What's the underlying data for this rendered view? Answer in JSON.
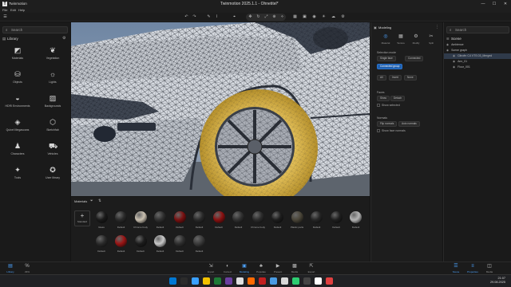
{
  "window": {
    "app_name": "Twinmotion",
    "title": "Twinmotion 2025.1.1 - Ohnetitel*",
    "minimize": "—",
    "maximize": "☐",
    "close": "✕"
  },
  "menu": [
    "File",
    "Edit",
    "Help"
  ],
  "left_panel": {
    "search_placeholder": "Search",
    "section_title": "Library",
    "items": [
      {
        "label": "Materials",
        "icon": "materials-icon",
        "glyph": "◩"
      },
      {
        "label": "Vegetation",
        "icon": "vegetation-icon",
        "glyph": "❦"
      },
      {
        "label": "Objects",
        "icon": "objects-icon",
        "glyph": "⛁"
      },
      {
        "label": "Lights",
        "icon": "lights-icon",
        "glyph": "☼"
      },
      {
        "label": "HDRI Environments",
        "icon": "hdri-icon",
        "glyph": "◒"
      },
      {
        "label": "Backgrounds",
        "icon": "backgrounds-icon",
        "glyph": "▨"
      },
      {
        "label": "Quixel Megascans",
        "icon": "megascans-icon",
        "glyph": "◈"
      },
      {
        "label": "Sketchfab",
        "icon": "sketchfab-icon",
        "glyph": "⬡"
      },
      {
        "label": "Characters",
        "icon": "characters-icon",
        "glyph": "♟"
      },
      {
        "label": "Vehicles",
        "icon": "vehicles-icon",
        "glyph": "⛟"
      },
      {
        "label": "Tools",
        "icon": "tools-icon",
        "glyph": "✦"
      },
      {
        "label": "User library",
        "icon": "user-library-icon",
        "glyph": "✪"
      }
    ]
  },
  "materials_panel": {
    "title": "Materials",
    "add_label": "Standard",
    "swatches": [
      {
        "label": "Glass",
        "color": "#1a1a1a"
      },
      {
        "label": "Default",
        "color": "#2a2a2a"
      },
      {
        "label": "Chrome body",
        "color": "#c9c0b0"
      },
      {
        "label": "Default",
        "color": "#303030"
      },
      {
        "label": "Default",
        "color": "#7a1010"
      },
      {
        "label": "Default",
        "color": "#2a2a2a"
      },
      {
        "label": "Default",
        "color": "#8a1010"
      },
      {
        "label": "Default",
        "color": "#303030"
      },
      {
        "label": "Chrome body",
        "color": "#2c2c2c"
      },
      {
        "label": "Default",
        "color": "#1d1d1d"
      },
      {
        "label": "Plastic parts",
        "color": "#4a4538"
      },
      {
        "label": "Default",
        "color": "#262626"
      },
      {
        "label": "Default",
        "color": "#1f1f1f"
      },
      {
        "label": "Default",
        "color": "#b5b5b5"
      },
      {
        "label": "Default",
        "color": "#2b2b2b"
      },
      {
        "label": "Default",
        "color": "#9a1414"
      },
      {
        "label": "Default",
        "color": "#1c1c1c"
      },
      {
        "label": "Default",
        "color": "#c8c8c8"
      },
      {
        "label": "Default",
        "color": "#2e2e2e"
      },
      {
        "label": "Default",
        "color": "#3a3a3a"
      }
    ]
  },
  "right_panel": {
    "title": "Modeling",
    "tabs": [
      {
        "label": "Material",
        "icon": "material-tab-icon",
        "glyph": "◎"
      },
      {
        "label": "Texture",
        "icon": "texture-tab-icon",
        "glyph": "▦"
      },
      {
        "label": "Modify",
        "icon": "modify-tab-icon",
        "glyph": "⚙"
      },
      {
        "label": "Split",
        "icon": "split-tab-icon",
        "glyph": "✂"
      }
    ],
    "selection_mode_label": "Selection mode",
    "btn_single": "Single face",
    "btn_connected": "Connected",
    "btn_group": "Connected group",
    "btn_all": "All",
    "btn_invert": "Invert",
    "btn_none": "None",
    "faces_label": "Faces",
    "btn_show": "Show",
    "btn_detach": "Detach",
    "show_selected": "Show selected",
    "normals_label": "Normals",
    "btn_flip": "Flip normals",
    "btn_auto": "Auto normals",
    "show_normals": "Show face normals"
  },
  "scene_panel": {
    "search_placeholder": "Search",
    "title": "Scene",
    "rows": [
      {
        "label": "Ambience",
        "indent": 0,
        "selected": false
      },
      {
        "label": "Scene graph",
        "indent": 0,
        "selected": false
      },
      {
        "label": "Citroën C4 VTS 03_Merged",
        "indent": 1,
        "selected": true
      },
      {
        "label": "Ann_01",
        "indent": 1,
        "selected": false
      },
      {
        "label": "Floor_001",
        "indent": 1,
        "selected": false
      }
    ]
  },
  "modebar": {
    "left": [
      {
        "label": "Library",
        "icon": "library-mode-icon",
        "glyph": "▤",
        "active": true
      },
      {
        "label": "29%",
        "icon": "percent-icon",
        "glyph": "%",
        "active": false
      }
    ],
    "center": [
      {
        "label": "Import",
        "icon": "import-icon",
        "glyph": "⇲",
        "active": false
      },
      {
        "label": "Context",
        "icon": "context-icon",
        "glyph": "◐",
        "active": false
      },
      {
        "label": "Modeling",
        "icon": "modeling-icon",
        "glyph": "▣",
        "active": true
      },
      {
        "label": "Populate",
        "icon": "populate-icon",
        "glyph": "♣",
        "active": false
      },
      {
        "label": "Present",
        "icon": "present-icon",
        "glyph": "▶",
        "active": false
      },
      {
        "label": "Media",
        "icon": "media-icon",
        "glyph": "▩",
        "active": false
      },
      {
        "label": "Export",
        "icon": "export-icon",
        "glyph": "⇱",
        "active": false
      }
    ],
    "right": [
      {
        "label": "Scene",
        "icon": "scene-mode-icon",
        "glyph": "☰",
        "active": true
      },
      {
        "label": "Properties",
        "icon": "properties-icon",
        "glyph": "≡",
        "active": true
      },
      {
        "label": "Media",
        "icon": "media-right-icon",
        "glyph": "◫",
        "active": false
      }
    ]
  },
  "taskbar": {
    "time": "21:07",
    "date": "29.08.2025",
    "icons": [
      "#0078d4",
      "#2b2b2b",
      "#3aa0ff",
      "#f2c200",
      "#1e7a36",
      "#6b3fa0",
      "#e0e0e0",
      "#ff6a00",
      "#c21f1f",
      "#4a9be3",
      "#d8d8d8",
      "#2ecc71",
      "#444444",
      "#ffffff",
      "#e04040"
    ]
  }
}
